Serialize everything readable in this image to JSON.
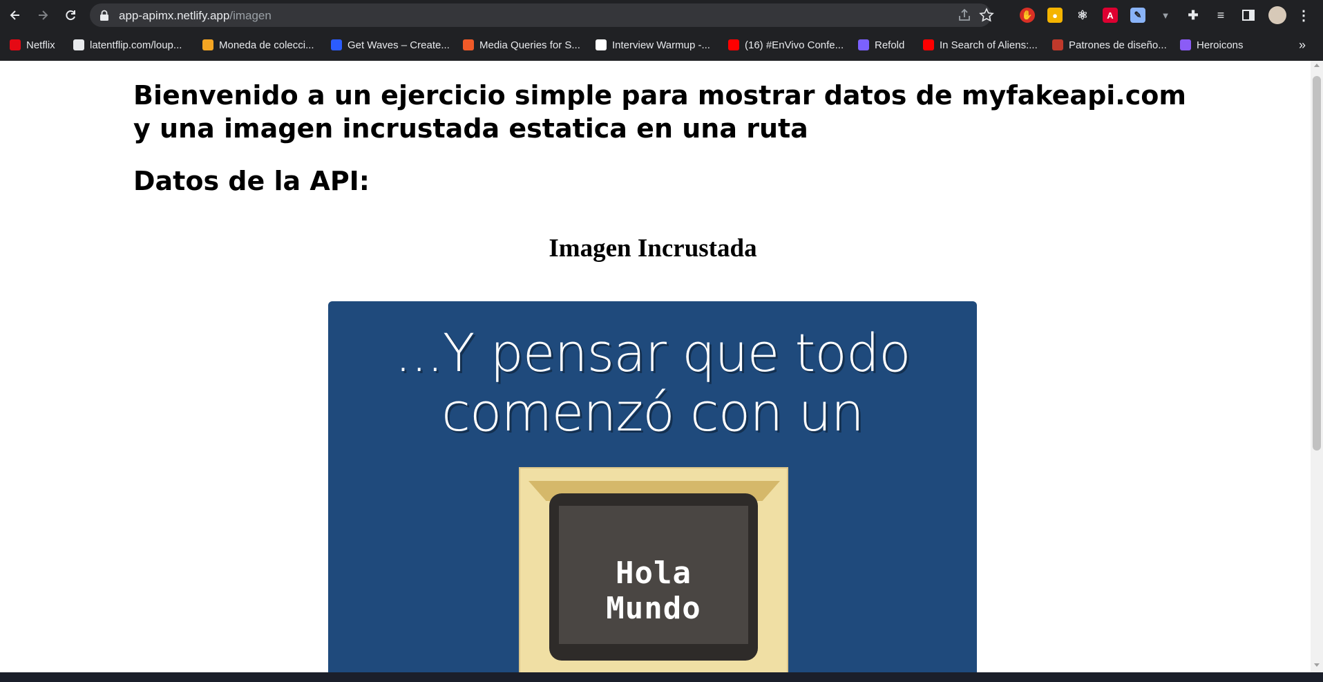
{
  "browser": {
    "url_host": "app-apimx.netlify.app",
    "url_path": "/imagen",
    "bookmarks": [
      {
        "label": "Netflix",
        "color": "#e50914"
      },
      {
        "label": "latentflip.com/loup...",
        "color": "#e8eaed"
      },
      {
        "label": "Moneda de colecci...",
        "color": "#f5a623"
      },
      {
        "label": "Get Waves – Create...",
        "color": "#2b5cff"
      },
      {
        "label": "Media Queries for S...",
        "color": "#f05a28"
      },
      {
        "label": "Interview Warmup -...",
        "color": "#ffffff"
      },
      {
        "label": "(16) #EnVivo Confe...",
        "color": "#ff0000"
      },
      {
        "label": "Refold",
        "color": "#7b61ff"
      },
      {
        "label": "In Search of Aliens:...",
        "color": "#ff0000"
      },
      {
        "label": "Patrones de diseño...",
        "color": "#c0392b"
      },
      {
        "label": "Heroicons",
        "color": "#8b5cf6"
      }
    ],
    "more_bookmarks": "»"
  },
  "page": {
    "title": "Bienvenido a un ejercicio simple para mostrar datos de myfakeapi.com y una imagen incrustada estatica en una ruta",
    "api_heading": "Datos de la API:",
    "image_heading": "Imagen Incrustada",
    "image": {
      "caption_line1": "...Y pensar que todo",
      "caption_line2": "comenzó con un",
      "screen_text": "Hola Mundo",
      "background_color": "#1f4a7c"
    }
  }
}
